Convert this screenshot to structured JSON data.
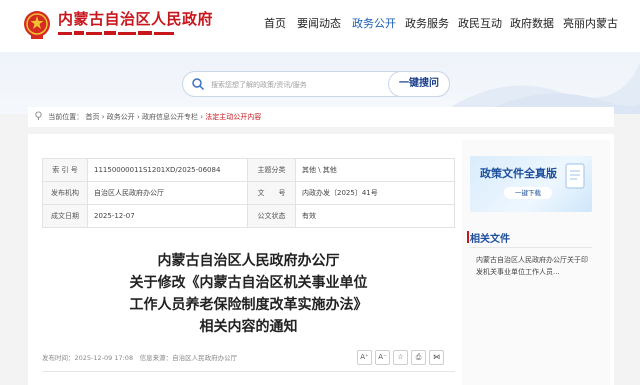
{
  "header": {
    "site_title": "内蒙古自治区人民政府",
    "nav": [
      {
        "label": "首页",
        "active": false
      },
      {
        "label": "要闻动态",
        "active": false
      },
      {
        "label": "政务公开",
        "active": true
      },
      {
        "label": "政务服务",
        "active": false
      },
      {
        "label": "政民互动",
        "active": false
      },
      {
        "label": "政府数据",
        "active": false
      },
      {
        "label": "亮丽内蒙古",
        "active": false
      }
    ]
  },
  "search": {
    "placeholder": "搜索您想了解的政策/资讯/服务",
    "button_label": "一键搜问"
  },
  "breadcrumb": {
    "prefix": "当前位置：",
    "items": [
      "首页",
      "政务公开",
      "政府信息公开专栏",
      "法定主动公开内容"
    ],
    "separator": " › "
  },
  "info_table": {
    "rows": [
      {
        "label1": "索 引 号",
        "value1": "11150000011S1201XD/2025-06084",
        "label2": "主题分类",
        "value2": "其他 \\ 其他"
      },
      {
        "label1": "发布机构",
        "value1": "自治区人民政府办公厅",
        "label2": "文　　号",
        "value2": "内政办发〔2025〕41号"
      },
      {
        "label1": "成文日期",
        "value1": "2025-12-07",
        "label2": "公文状态",
        "value2": "有效"
      }
    ]
  },
  "document": {
    "title_lines": [
      "内蒙古自治区人民政府办公厅",
      "关于修改《内蒙古自治区机关事业单位",
      "工作人员养老保险制度改革实施办法》",
      "相关内容的通知"
    ],
    "publish_line": "发布时间：2025-12-09 17:08　信息来源：自治区人民政府办公厅",
    "tools": [
      "A⁺",
      "A⁻",
      "☆",
      "⎙",
      "⋈"
    ]
  },
  "sidebar": {
    "promo_title": "政策文件全真版",
    "promo_button": "一键下载",
    "related_heading": "相关文件",
    "related_items": [
      "内蒙古自治区人民政府办公厅关于印发机关事业单位工作人员..."
    ]
  },
  "colors": {
    "brand_red": "#c8161d",
    "brand_blue": "#1d4f9c",
    "nav_active": "#1a5fb4"
  }
}
